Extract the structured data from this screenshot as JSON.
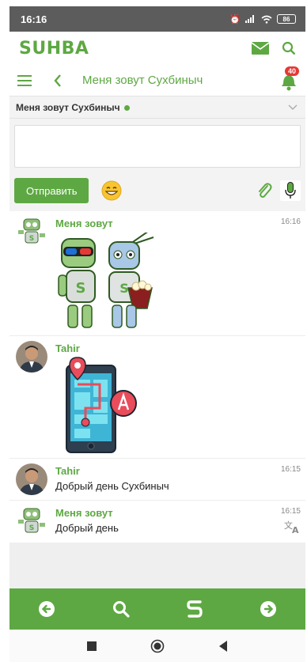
{
  "status_bar": {
    "time": "16:16",
    "battery": "86"
  },
  "app": {
    "logo": "SUHBA",
    "notification_count": "40"
  },
  "nav": {
    "title": "Меня зовут Сухбиныч"
  },
  "channel": {
    "name": "Меня зовут Сухбиныч"
  },
  "composer": {
    "send_label": "Отправить",
    "input_value": ""
  },
  "messages": [
    {
      "author": "Меня зовут",
      "time": "16:16",
      "type": "sticker-robots"
    },
    {
      "author": "Tahir",
      "time": "",
      "type": "sticker-map"
    },
    {
      "author": "Tahir",
      "time": "16:15",
      "text": "Добрый день Сухбиныч"
    },
    {
      "author": "Меня зовут",
      "time": "16:15",
      "text": "Добрый день"
    }
  ],
  "colors": {
    "accent": "#5ea843",
    "status_bar": "#5c5c5c",
    "badge": "#e53935"
  },
  "icons": [
    "envelope-icon",
    "search-icon",
    "menu-icon",
    "back-icon",
    "bell-icon",
    "chevron-down-icon",
    "emoji-icon",
    "paperclip-icon",
    "microphone-icon",
    "translate-icon",
    "arrow-left-icon",
    "s-logo-icon",
    "arrow-right-icon"
  ]
}
